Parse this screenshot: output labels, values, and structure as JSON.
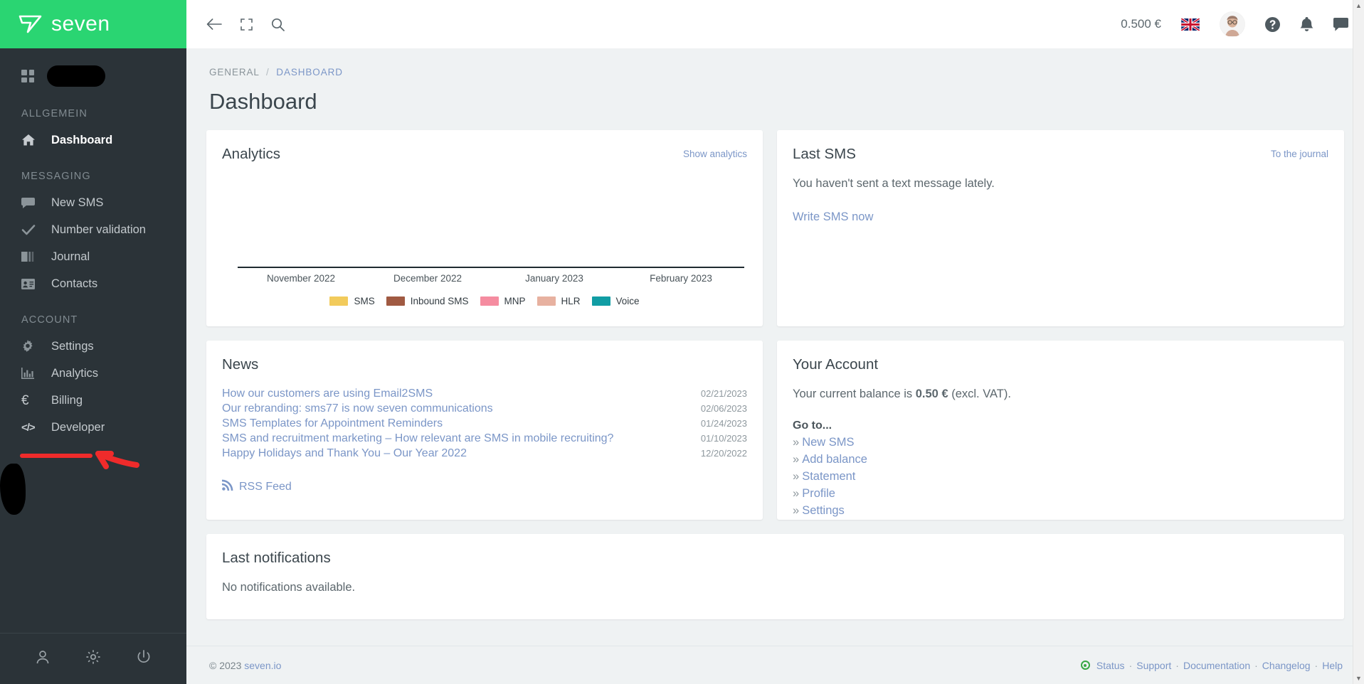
{
  "brand": {
    "name": "seven",
    "logo_icon": "seven-logo-icon"
  },
  "sidebar": {
    "account_name_redacted": "",
    "groups": [
      {
        "label": "ALLGEMEIN",
        "items": [
          {
            "label": "Dashboard",
            "icon": "home-icon",
            "active": true
          }
        ]
      },
      {
        "label": "MESSAGING",
        "items": [
          {
            "label": "New SMS",
            "icon": "chat-bubble-icon",
            "active": false
          },
          {
            "label": "Number validation",
            "icon": "check-icon",
            "active": false
          },
          {
            "label": "Journal",
            "icon": "book-icon",
            "active": false
          },
          {
            "label": "Contacts",
            "icon": "contact-card-icon",
            "active": false
          }
        ]
      },
      {
        "label": "ACCOUNT",
        "items": [
          {
            "label": "Settings",
            "icon": "gear-icon",
            "active": false
          },
          {
            "label": "Analytics",
            "icon": "bar-chart-icon",
            "active": false
          },
          {
            "label": "Billing",
            "icon": "euro-icon",
            "active": false
          },
          {
            "label": "Developer",
            "icon": "code-icon",
            "active": false
          }
        ]
      }
    ],
    "footer_icons": [
      "user-icon",
      "gear-icon",
      "power-icon"
    ]
  },
  "topbar": {
    "back_icon": "back-arrow-icon",
    "fullscreen_icon": "fullscreen-icon",
    "search_icon": "search-icon",
    "balance": "0.500 €",
    "language_icon": "uk-flag-icon",
    "avatar_icon": "user-avatar",
    "help_icon": "help-icon",
    "notifications_icon": "bell-icon",
    "messages_icon": "chat-icon"
  },
  "breadcrumb": {
    "root": "GENERAL",
    "separator": "/",
    "current": "DASHBOARD"
  },
  "page": {
    "title": "Dashboard"
  },
  "analytics_card": {
    "title": "Analytics",
    "link": "Show analytics"
  },
  "chart_data": {
    "type": "bar",
    "title": "Analytics",
    "categories": [
      "November 2022",
      "December 2022",
      "January 2023",
      "February 2023"
    ],
    "series": [
      {
        "name": "SMS",
        "color": "#f2cb5c",
        "values": [
          0,
          0,
          0,
          0
        ]
      },
      {
        "name": "Inbound SMS",
        "color": "#a05a42",
        "values": [
          0,
          0,
          0,
          0
        ]
      },
      {
        "name": "MNP",
        "color": "#f58ca0",
        "values": [
          0,
          0,
          0,
          0
        ]
      },
      {
        "name": "HLR",
        "color": "#e7b1a0",
        "values": [
          0,
          0,
          0,
          0
        ]
      },
      {
        "name": "Voice",
        "color": "#119da4",
        "values": [
          0,
          0,
          0,
          0
        ]
      }
    ],
    "xlabel": "",
    "ylabel": "",
    "ylim": [
      0,
      0
    ],
    "grid": false,
    "legend_position": "bottom"
  },
  "last_sms_card": {
    "title": "Last SMS",
    "link": "To the journal",
    "empty_text": "You haven't sent a text message lately.",
    "action": "Write SMS now"
  },
  "news_card": {
    "title": "News",
    "items": [
      {
        "title": "How our customers are using Email2SMS",
        "date": "02/21/2023"
      },
      {
        "title": "Our rebranding: sms77 is now seven communications",
        "date": "02/06/2023"
      },
      {
        "title": "SMS Templates for Appointment Reminders",
        "date": "01/24/2023"
      },
      {
        "title": "SMS and recruitment marketing – How relevant are SMS in mobile recruiting?",
        "date": "01/10/2023"
      },
      {
        "title": "Happy Holidays and Thank You – Our Year 2022",
        "date": "12/20/2022"
      }
    ],
    "rss_label": "RSS Feed",
    "rss_icon": "rss-icon"
  },
  "account_card": {
    "title": "Your Account",
    "balance_prefix": "Your current balance is ",
    "balance_value": "0.50 €",
    "balance_suffix": " (excl. VAT).",
    "goto_label": "Go to...",
    "links": [
      "New SMS",
      "Add balance",
      "Statement",
      "Profile",
      "Settings"
    ],
    "chevron": "»"
  },
  "notifications_card": {
    "title": "Last notifications",
    "empty_text": "No notifications available."
  },
  "footer": {
    "copyright": "© 2023 ",
    "brand_link": "seven.io",
    "status_label": "Status",
    "links": [
      "Support",
      "Documentation",
      "Changelog",
      "Help"
    ],
    "separator": "·"
  },
  "annotation": {
    "type": "red-underline-and-arrow",
    "target": "Developer",
    "color": "#ef2b2b"
  },
  "colors": {
    "brand_green": "#2ad572",
    "sidebar_bg": "#2b3338",
    "page_bg": "#eff2f3",
    "link_blue": "#7b96c7",
    "annotation_red": "#ef2b2b"
  }
}
